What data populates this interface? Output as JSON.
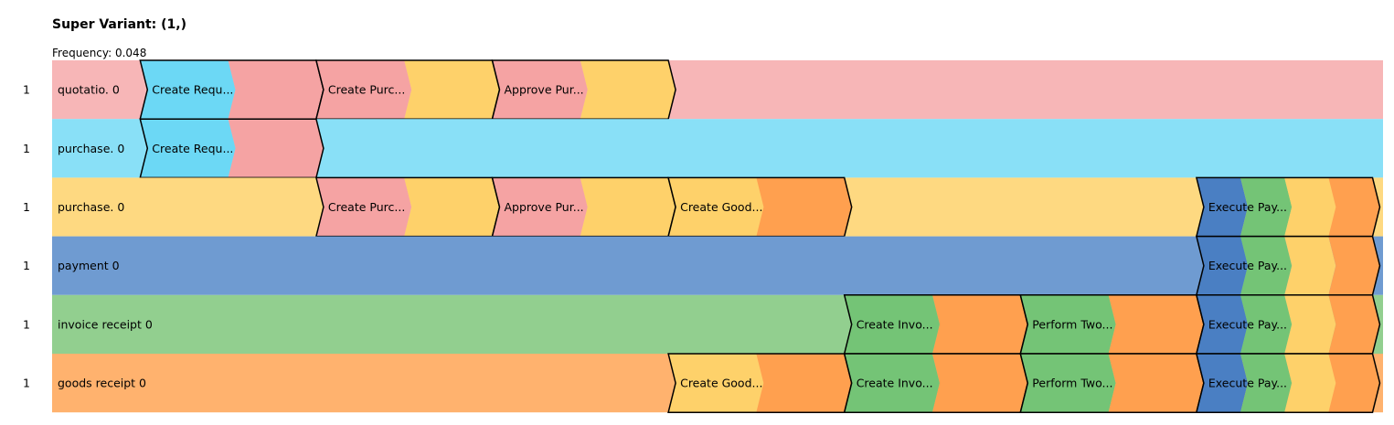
{
  "title": "Super Variant: (1,)",
  "frequency_label": "Frequency: 0.048",
  "colors": {
    "quotation_lane": "#f7b6b7",
    "purchase_req_lane": "#89e0f7",
    "purchase_order_lane": "#fed981",
    "payment_lane": "#6f9bd1",
    "invoice_lane": "#92cf8f",
    "goods_lane": "#ffb26e",
    "seg_pink": "#f5a3a3",
    "seg_cyan": "#6cd8f5",
    "seg_yellow": "#fed16a",
    "seg_orange": "#ffa04f",
    "seg_green": "#74c476",
    "seg_blue": "#4a7fc3"
  },
  "lanes": [
    {
      "name": "quotatio. 0",
      "count": "1",
      "color": "quotation_lane",
      "activities": [
        {
          "label": "Create Requ...",
          "start": 1,
          "end": 3,
          "segments": [
            "seg_cyan",
            "seg_pink"
          ]
        },
        {
          "label": "Create Purc...",
          "start": 3,
          "end": 5,
          "segments": [
            "seg_pink",
            "seg_yellow"
          ]
        },
        {
          "label": "Approve Pur...",
          "start": 5,
          "end": 7,
          "segments": [
            "seg_pink",
            "seg_yellow"
          ]
        }
      ]
    },
    {
      "name": "purchase. 0",
      "count": "1",
      "color": "purchase_req_lane",
      "activities": [
        {
          "label": "Create Requ...",
          "start": 1,
          "end": 3,
          "segments": [
            "seg_cyan",
            "seg_pink"
          ]
        }
      ]
    },
    {
      "name": "purchase. 0",
      "count": "1",
      "color": "purchase_order_lane",
      "activities": [
        {
          "label": "Create Purc...",
          "start": 3,
          "end": 5,
          "segments": [
            "seg_pink",
            "seg_yellow"
          ]
        },
        {
          "label": "Approve Pur...",
          "start": 5,
          "end": 7,
          "segments": [
            "seg_pink",
            "seg_yellow"
          ]
        },
        {
          "label": "Create Good...",
          "start": 7,
          "end": 9,
          "segments": [
            "seg_yellow",
            "seg_orange"
          ]
        },
        {
          "label": "Execute Pay...",
          "start": 13,
          "end": 15,
          "segments": [
            "seg_blue",
            "seg_green",
            "seg_yellow",
            "seg_orange"
          ]
        }
      ]
    },
    {
      "name": "payment 0",
      "count": "1",
      "color": "payment_lane",
      "activities": [
        {
          "label": "Execute Pay...",
          "start": 13,
          "end": 15,
          "segments": [
            "seg_blue",
            "seg_green",
            "seg_yellow",
            "seg_orange"
          ]
        }
      ]
    },
    {
      "name": "invoice receipt 0",
      "count": "1",
      "color": "invoice_lane",
      "activities": [
        {
          "label": "Create Invo...",
          "start": 9,
          "end": 11,
          "segments": [
            "seg_green",
            "seg_orange"
          ]
        },
        {
          "label": "Perform Two...",
          "start": 11,
          "end": 13,
          "segments": [
            "seg_green",
            "seg_orange"
          ]
        },
        {
          "label": "Execute Pay...",
          "start": 13,
          "end": 15,
          "segments": [
            "seg_blue",
            "seg_green",
            "seg_yellow",
            "seg_orange"
          ]
        }
      ]
    },
    {
      "name": "goods receipt 0",
      "count": "1",
      "color": "goods_lane",
      "activities": [
        {
          "label": "Create Good...",
          "start": 7,
          "end": 9,
          "segments": [
            "seg_yellow",
            "seg_orange"
          ]
        },
        {
          "label": "Create Invo...",
          "start": 9,
          "end": 11,
          "segments": [
            "seg_green",
            "seg_orange"
          ]
        },
        {
          "label": "Perform Two...",
          "start": 11,
          "end": 13,
          "segments": [
            "seg_green",
            "seg_orange"
          ]
        },
        {
          "label": "Execute Pay...",
          "start": 13,
          "end": 15,
          "segments": [
            "seg_blue",
            "seg_green",
            "seg_yellow",
            "seg_orange"
          ]
        }
      ]
    }
  ]
}
